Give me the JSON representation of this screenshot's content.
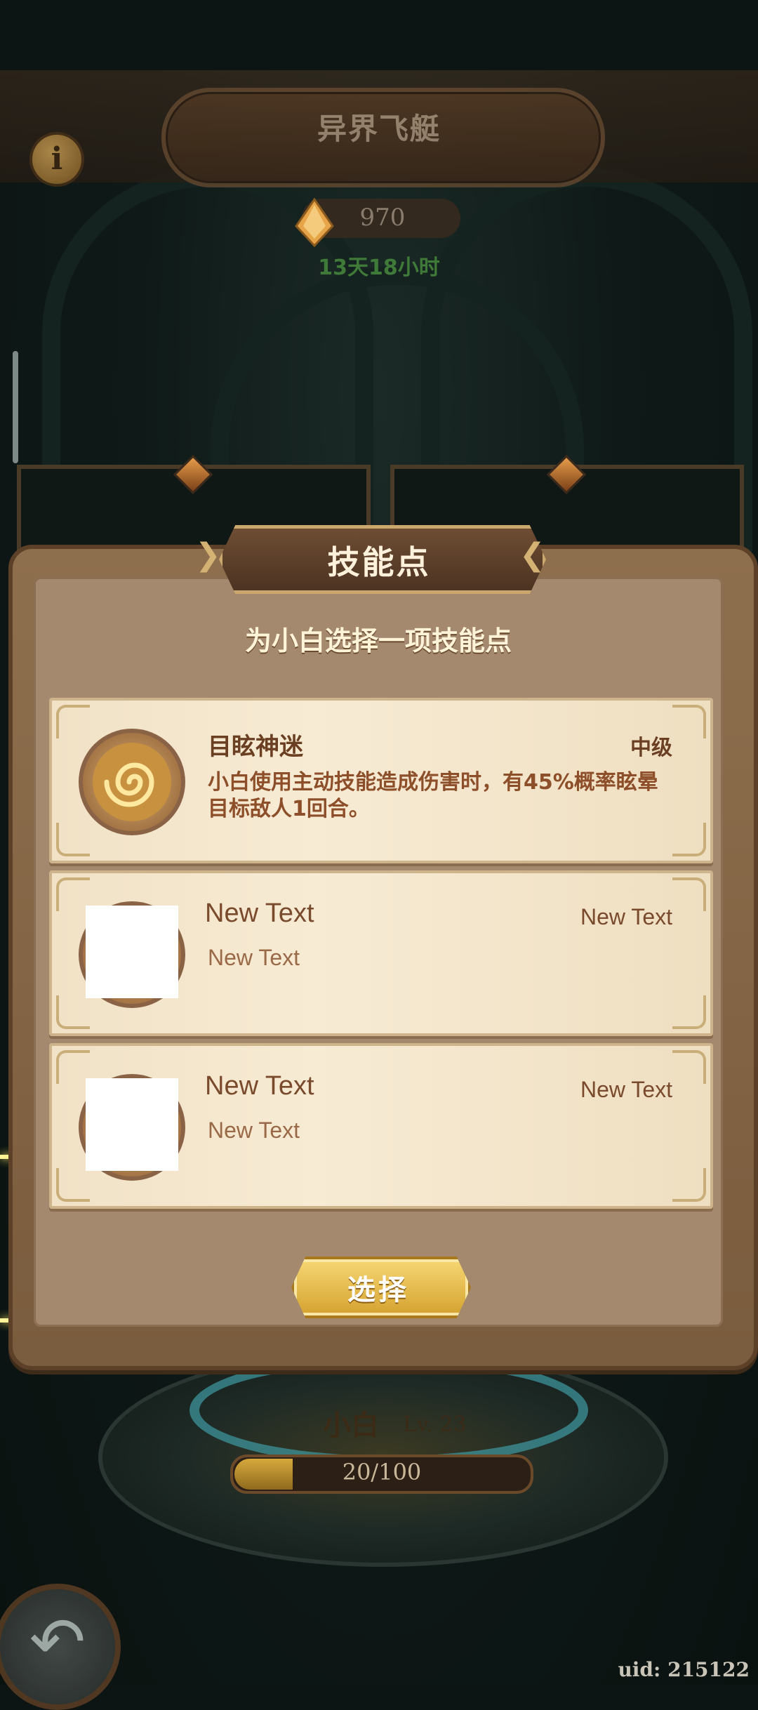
{
  "header": {
    "title": "异界飞艇",
    "info_icon": "info-icon",
    "currency_value": "970",
    "currency_icon": "crystal-icon",
    "timer": "13天18小时"
  },
  "dialog": {
    "title": "技能点",
    "subtitle": "为小白选择一项技能点",
    "options": [
      {
        "name": "目眩神迷",
        "level": "中级",
        "description": "小白使用主动技能造成伤害时，有45%概率眩晕目标敌人1回合。",
        "icon": "swirl-orb-icon"
      },
      {
        "name": "New Text",
        "level": "New Text",
        "description": "New Text"
      },
      {
        "name": "New Text",
        "level": "New Text",
        "description": "New Text"
      }
    ],
    "select_label": "选择"
  },
  "character": {
    "name": "小白",
    "level": "Lv. 23",
    "xp_text": "20/100",
    "xp_fraction": 0.2
  },
  "footer": {
    "back_icon": "back-arrow-icon",
    "uid": "uid: 215122"
  },
  "colors": {
    "accent_gold": "#d4a22f",
    "dialog_brown": "#8e6f4d",
    "timer_green": "#3f7a38"
  }
}
